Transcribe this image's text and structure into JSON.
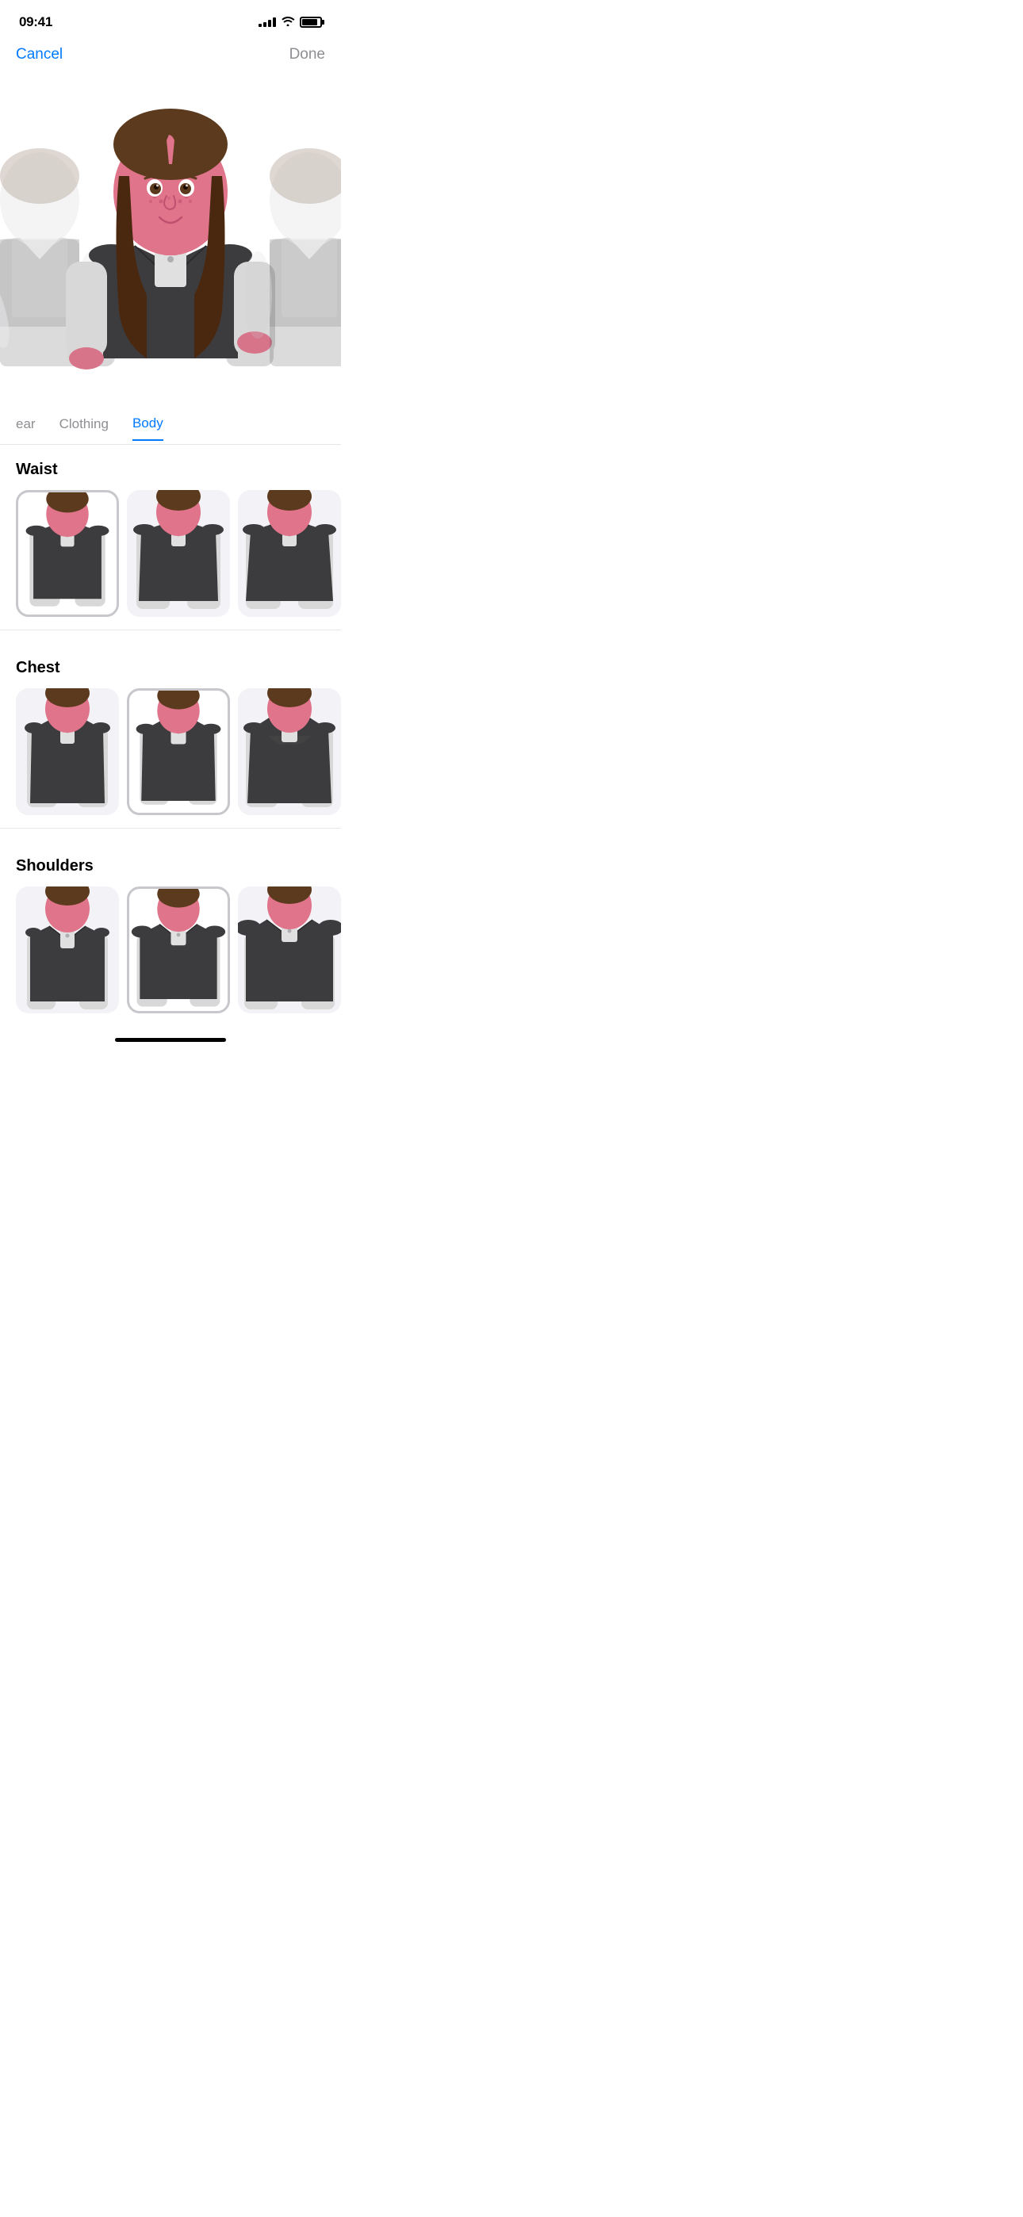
{
  "statusBar": {
    "time": "09:41",
    "signalBars": [
      3,
      5,
      7,
      9,
      11
    ],
    "batteryLevel": 85
  },
  "navigation": {
    "cancelLabel": "Cancel",
    "doneLabel": "Done"
  },
  "tabs": [
    {
      "id": "headwear",
      "label": "ear"
    },
    {
      "id": "clothing",
      "label": "Clothing"
    },
    {
      "id": "body",
      "label": "Body",
      "active": true
    }
  ],
  "sections": [
    {
      "id": "waist",
      "title": "Waist",
      "items": [
        {
          "id": "waist-1",
          "selected": true
        },
        {
          "id": "waist-2",
          "selected": false
        },
        {
          "id": "waist-3",
          "selected": false
        }
      ]
    },
    {
      "id": "chest",
      "title": "Chest",
      "items": [
        {
          "id": "chest-1",
          "selected": false
        },
        {
          "id": "chest-2",
          "selected": true
        },
        {
          "id": "chest-3",
          "selected": false
        }
      ]
    },
    {
      "id": "shoulders",
      "title": "Shoulders",
      "items": [
        {
          "id": "shoulders-1",
          "selected": false
        },
        {
          "id": "shoulders-2",
          "selected": true
        },
        {
          "id": "shoulders-3",
          "selected": false
        }
      ]
    }
  ],
  "colors": {
    "activeTab": "#007AFF",
    "inactiveTab": "#8E8E93",
    "selectedBorder": "#C7C7CC",
    "sectionDivider": "#E5E5EA",
    "vestDark": "#3C3C3E",
    "vestMid": "#48484A",
    "sleeveLight": "#D8D8D8",
    "skinPink": "#E0748A",
    "hairBrown": "#5C3A1E",
    "buttonGray": "#AEAEB2"
  }
}
